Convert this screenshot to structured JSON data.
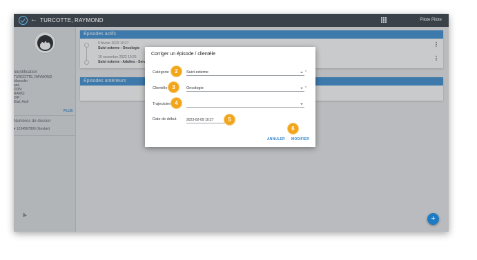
{
  "topbar": {
    "patient_name": "TURCOTTE, RAYMOND",
    "user_name": "Pilote Pilote",
    "logo_icon": "check-circle-icon",
    "back_icon": "arrow-left-icon",
    "apps_icon": "apps-grid-icon"
  },
  "sidebar": {
    "avatar_icon": "avatar-face-icon",
    "identification_heading": "Identification",
    "lines": [
      "TURCOTTE, RAYMOND",
      "Masculin",
      "ans",
      "DDN:",
      "RAMQ:",
      "DIP:",
      "Etat: Actif"
    ],
    "plus_label": "PLUS",
    "dossier_heading": "Numéros de dossier",
    "dossier_item": "▾ 1234567890 (Gustav)"
  },
  "active_panel": {
    "title": "Épisodes actifs",
    "episodes": [
      {
        "date": "9 février 2023 10:27",
        "title": "Suivi externe - Oncologie"
      },
      {
        "date": "10 novembre 2022 10:25",
        "title": "Suivi externe - Adultes - Service"
      }
    ]
  },
  "previous_panel": {
    "title": "Épisodes antérieurs"
  },
  "dialog": {
    "title": "Corriger un épisode / clientèle",
    "fields": {
      "categorie": {
        "label": "Catégorie",
        "value": "Suivi externe",
        "badge": "2"
      },
      "clientele": {
        "label": "Clientèle",
        "value": "Oncologie",
        "badge": "3"
      },
      "trajectoire": {
        "label": "Trajectoire",
        "value": "",
        "badge": "4"
      },
      "date_debut": {
        "label": "Date de début",
        "value": "2023-02-09 10:27",
        "badge": "5"
      }
    },
    "cancel_label": "ANNULER",
    "modify_label": "MODIFIER",
    "modify_badge": "6"
  },
  "fab": {
    "label": "+"
  },
  "colors": {
    "accent": "#3d8fd1",
    "badge": "#f2a41b",
    "topbar": "#3b4148"
  }
}
